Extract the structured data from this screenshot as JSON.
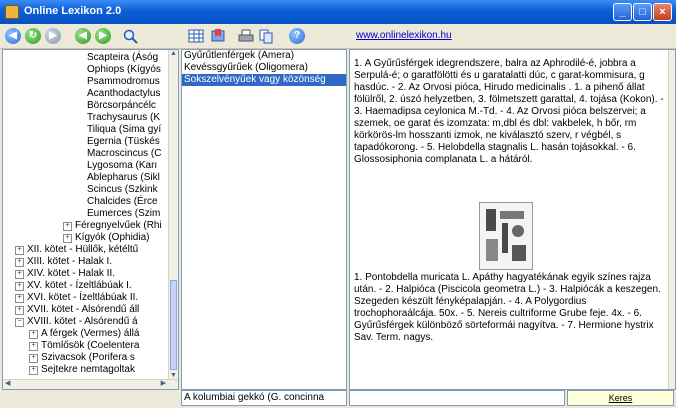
{
  "window": {
    "title": "Online Lexikon 2.0"
  },
  "toolbar": {
    "site_link": "www.onlinelexikon.hu"
  },
  "tree": {
    "items": [
      "Scapteira (Ásóg",
      "Ophiops (Kígyós",
      "Psammodromus",
      "Acanthodactylus",
      "Börcsorpáncélc",
      "Trachysaurus (K",
      "Tiliqua (Sima gyí",
      "Egernia (Tüskés",
      "Macroscincus (C",
      "Lygosoma (Karı",
      "Ablepharus (Sikl",
      "Scincus (Szkink",
      "Chalcides (Érce",
      "Eumerces (Szim",
      "Féregnyelvűek (Rhi",
      "Kígyók (Ophidia)",
      "XII. kötet - Hüllők, kétéltű",
      "XIII. kötet - Halak I.",
      "XIV. kötet - Halak II.",
      "XV. kötet - Ízeltlábúak I.",
      "XVI. kötet - Ízeltlábúak II.",
      "XVII. kötet - Alsórendű áll",
      "XVIII. kötet - Alsórendű á",
      "A férgek (Vermes) állá",
      "Tömlősök (Coelentera",
      "Szivacsok (Porifera s",
      "Sejtekre nemtagoltak"
    ]
  },
  "list": {
    "items": [
      "Gyűrűtlenférgek (Amera)",
      "Kevéssgyűrűek (Oligomera)",
      "Sokszelvényűek vagy közönség"
    ]
  },
  "article": {
    "para1": "1. A Gyűrűsférgek idegrendszere, balra az Aphrodilé-é, jobbra a Serpulá-é; o garatfölötti és u garatalatti dúc, c garat-kommisura, g hasdúc. - 2. Az Orvosi pióca, Hirudo medicinalis . 1. a pihenő állat fölülről, 2. úszó helyzetben, 3. fölmetszett garattal, 4. tojása (Kokon). - 3. Haemadipsa ceylonica M.-Td. - 4. Az Orvosi pióca belszervei; a szemek, oe garat és izomzata: m,dbl és dbl: vakbelek, h bőr, rm körkörös-lm hosszanti izmok, ne kiválasztó szerv, r végbél, s tapadókorong. - 5. Helobdella stagnalis L. hasán tojásokkal. - 6. Glossosiphonia complanata L. a hátáról.",
    "para2": "1. Pontobdella muricata L. Apáthy hagyatékának egyik színes rajza után. - 2. Halpióca (Piscicola geometra L.) - 3. Halpiócák a keszegen. Szegeden készült fényképalapján. - 4. A Polygordius trochophoraálcája. 50x. - 5. Nereis cultriforme Grube feje. 4x. - 6. Gyűrűsférgek különböző sörteformái nagyítva. - 7. Hermione hystrix Sav. Term. nagys."
  },
  "status": {
    "current_entry": "A kolumbiai gekkó (G. concinna",
    "search_value": "",
    "search_label": "Keres"
  }
}
